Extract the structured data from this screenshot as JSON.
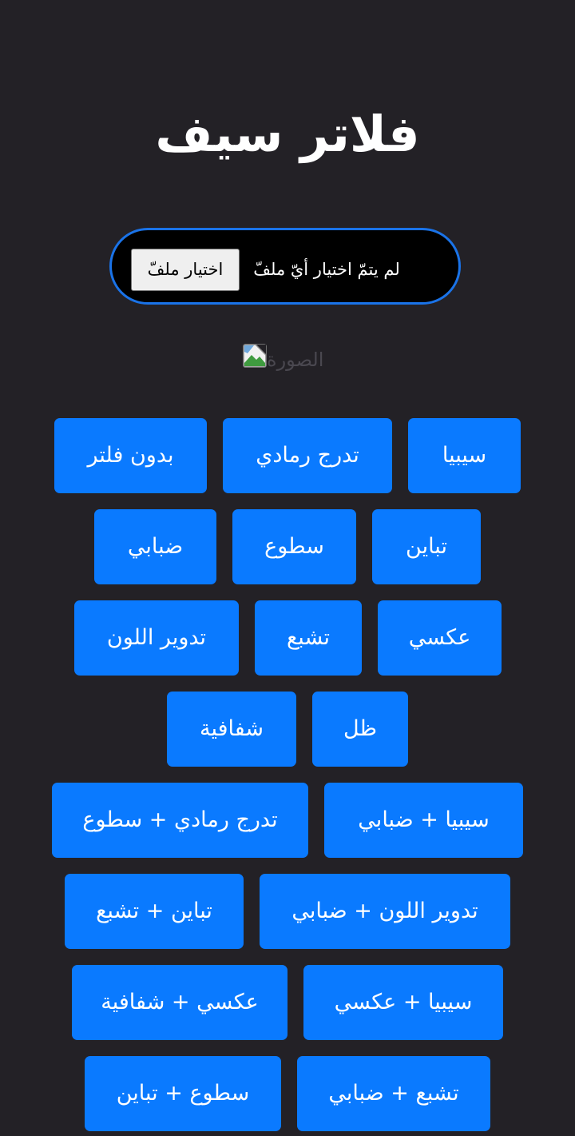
{
  "header": {
    "title": "فلاتر سيف"
  },
  "upload": {
    "button_label": "اختيار ملفّ",
    "status_text": "لم يتمّ اختيار أيّ ملفّ"
  },
  "preview": {
    "alt_text": "الصورة"
  },
  "filters": {
    "sepia": "سيبيا",
    "grayscale": "تدرج رمادي",
    "none": "بدون فلتر",
    "contrast": "تباين",
    "brightness": "سطوع",
    "blur": "ضبابي",
    "invert": "عكسي",
    "saturate": "تشبع",
    "hue_rotate": "تدوير اللون",
    "shadow": "ظل",
    "opacity": "شفافية",
    "sepia_blur": "سيبيا + ضبابي",
    "grayscale_brightness": "تدرج رمادي + سطوع",
    "hue_blur": "تدوير اللون + ضبابي",
    "contrast_saturate": "تباين + تشبع",
    "sepia_invert": "سيبيا + عكسي",
    "invert_opacity": "عكسي + شفافية",
    "saturate_blur": "تشبع + ضبابي",
    "brightness_contrast": "سطوع + تباين"
  }
}
